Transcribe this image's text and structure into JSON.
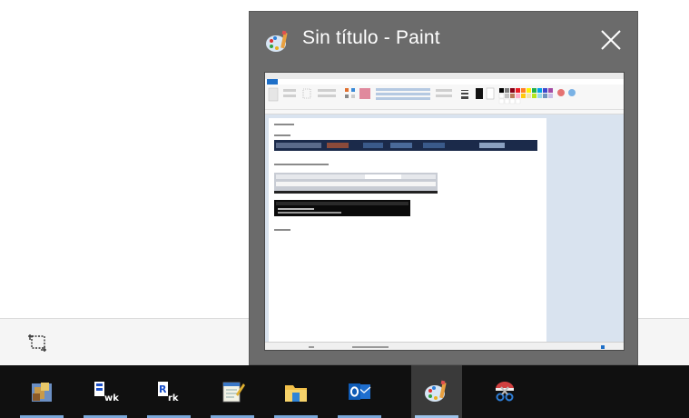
{
  "preview": {
    "title": "Sin título - Paint",
    "app_icon": "paint-palette-icon",
    "close_icon": "close-icon"
  },
  "background_window": {
    "tool_icon": "select-region-icon"
  },
  "taskbar": {
    "items": [
      {
        "icon": "package-app-icon",
        "active": false
      },
      {
        "icon": "wrk-file-icon",
        "active": false
      },
      {
        "icon": "rrk-file-icon",
        "active": false
      },
      {
        "icon": "notepad-icon",
        "active": false
      },
      {
        "icon": "file-explorer-icon",
        "active": false
      },
      {
        "icon": "outlook-icon",
        "active": false
      },
      {
        "icon": "paint-palette-icon",
        "active": true
      },
      {
        "icon": "snipping-tool-icon",
        "active": false
      }
    ]
  },
  "colors": {
    "taskbar": "#101010",
    "preview_bg": "#6b6b6b",
    "accent_underline": "#7aa7d9",
    "paint_blue": "#1e6fc8"
  }
}
